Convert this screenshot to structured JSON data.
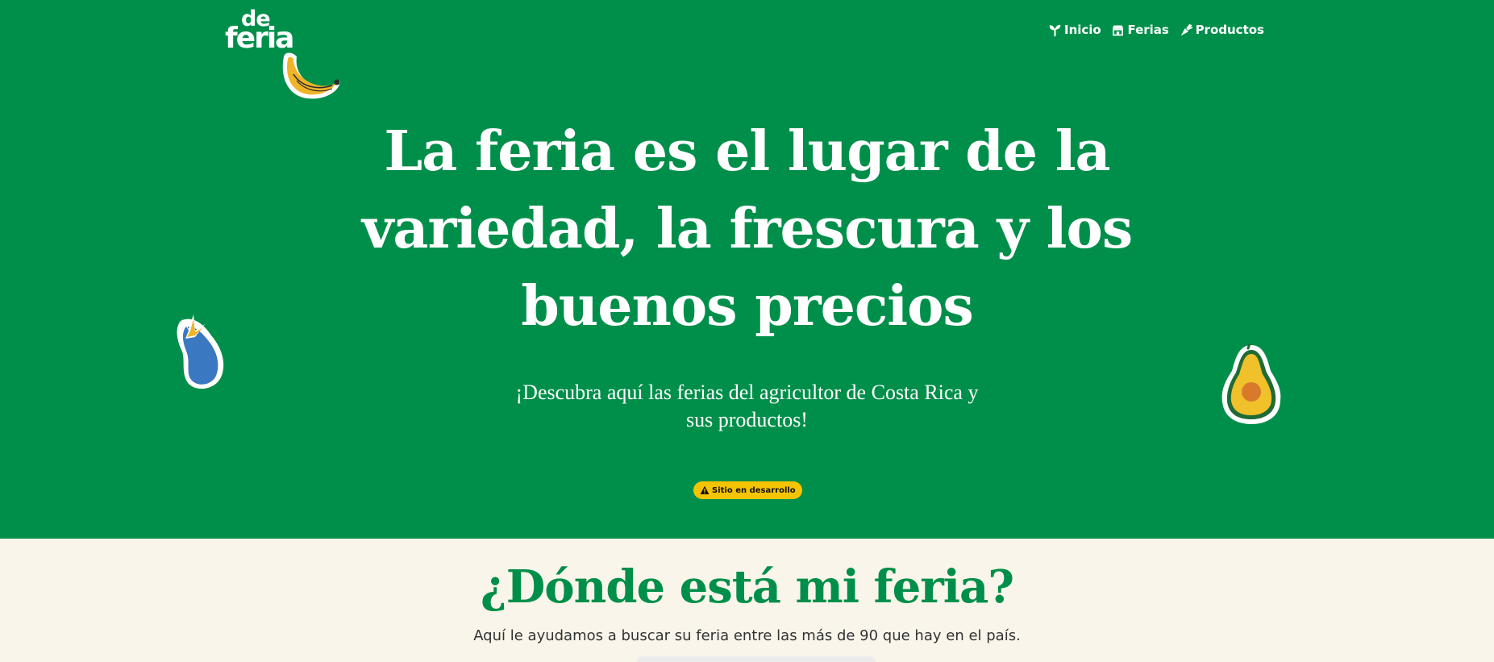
{
  "colors": {
    "brand_green": "#008f4a",
    "cream_background": "#faf5ea",
    "badge_yellow": "#f5c400"
  },
  "header": {
    "logo": {
      "line1": "de",
      "line2": "feria"
    },
    "nav": [
      {
        "label": "Inicio",
        "icon": "sprout-icon"
      },
      {
        "label": "Ferias",
        "icon": "store-icon"
      },
      {
        "label": "Productos",
        "icon": "carrot-icon"
      }
    ]
  },
  "hero": {
    "title": "La feria es el lugar de la variedad, la frescura y los buenos precios",
    "subtitle": "¡Descubra aquí las ferias del agricultor de Costa Rica y sus productos!",
    "badge": {
      "label": "Sitio en desarrollo",
      "icon": "warning-icon"
    },
    "stickers": [
      "banana-sticker",
      "eggplant-sticker",
      "avocado-sticker"
    ]
  },
  "section": {
    "title": "¿Dónde está mi feria?",
    "subtitle": "Aquí le ayudamos a buscar su feria entre las más de 90 que hay en el país."
  }
}
